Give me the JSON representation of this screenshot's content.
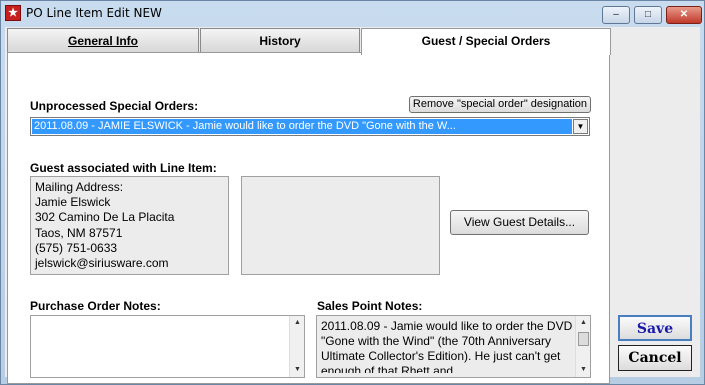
{
  "window": {
    "title": "PO Line Item Edit NEW",
    "app_icon": "app-logo-icon",
    "controls": {
      "minimize": "–",
      "maximize": "□",
      "close": "✕"
    }
  },
  "tabs": [
    {
      "label": "General Info",
      "active": false
    },
    {
      "label": "History",
      "active": false
    },
    {
      "label": "Guest / Special Orders",
      "active": true
    }
  ],
  "special_orders": {
    "label": "Unprocessed Special Orders:",
    "remove_button": "Remove \"special order\" designation",
    "selected": "2011.08.09 - JAMIE ELSWICK - Jamie would like to order the DVD \"Gone with the W..."
  },
  "guest": {
    "label": "Guest associated with Line Item:",
    "address_lines": [
      "Mailing Address:",
      "Jamie Elswick",
      "302 Camino De La Placita",
      "Taos, NM  87571",
      "(575) 751-0633",
      "jelswick@siriusware.com"
    ],
    "view_button": "View Guest Details..."
  },
  "po_notes": {
    "label": "Purchase Order Notes:",
    "value": ""
  },
  "sp_notes": {
    "label": "Sales Point Notes:",
    "value": "2011.08.09 - Jamie would like to order the DVD \"Gone with the Wind\" (the 70th Anniversary Ultimate Collector's Edition).  He just can't get enough of that Rhett and"
  },
  "actions": {
    "save": "Save",
    "cancel": "Cancel"
  },
  "colors": {
    "selection": "#3399ff",
    "save_text": "#1a1aa8",
    "window_frame": "#b6cde4"
  }
}
